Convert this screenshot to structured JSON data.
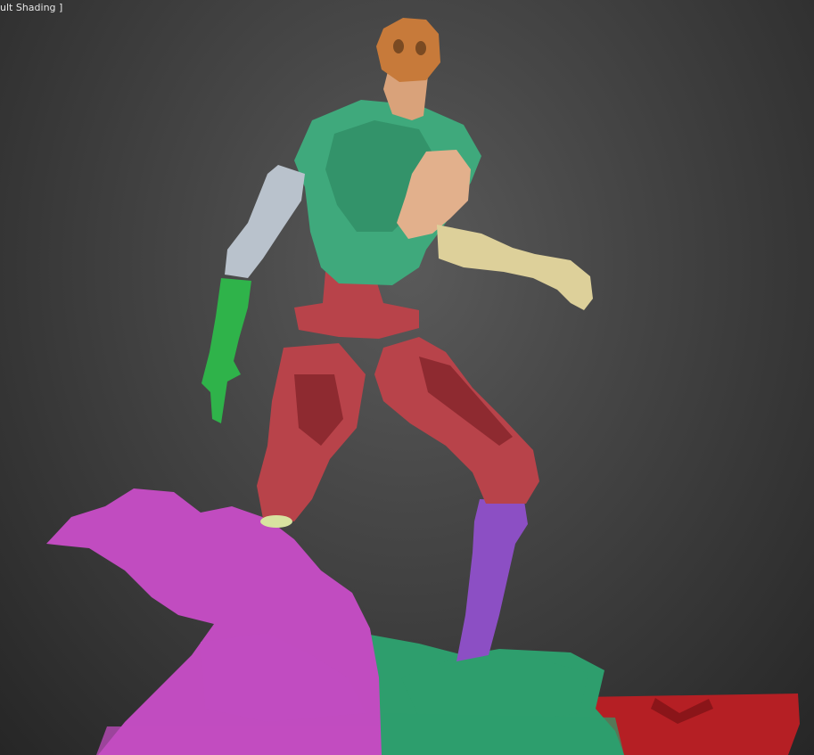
{
  "viewport": {
    "label": "ult Shading ]"
  },
  "colors": {
    "head": "#c77a3a",
    "neck": "#d9a27a",
    "torso": "#3fa97c",
    "arm_right_upper": "#b9c2cc",
    "arm_right_hand": "#2fb34a",
    "arm_left_upper": "#e2b08c",
    "arm_left_hand": "#ddd09a",
    "pelvis_legs": "#b8434a",
    "shin_right": "#8c4fc4",
    "rock_left": "#c14cc0",
    "rock_right": "#2e9e6d",
    "base_block": "#b51f24",
    "background": "#474747"
  },
  "scene_objects": [
    "head-mesh",
    "neck-mesh",
    "torso-mesh",
    "right-upper-arm-mesh",
    "right-hand-mesh",
    "left-upper-arm-mesh",
    "left-hand-mesh",
    "pelvis-mesh",
    "left-leg-mesh",
    "right-leg-mesh",
    "right-shin-mesh",
    "left-rock-mesh",
    "right-rock-mesh",
    "base-block-mesh"
  ]
}
